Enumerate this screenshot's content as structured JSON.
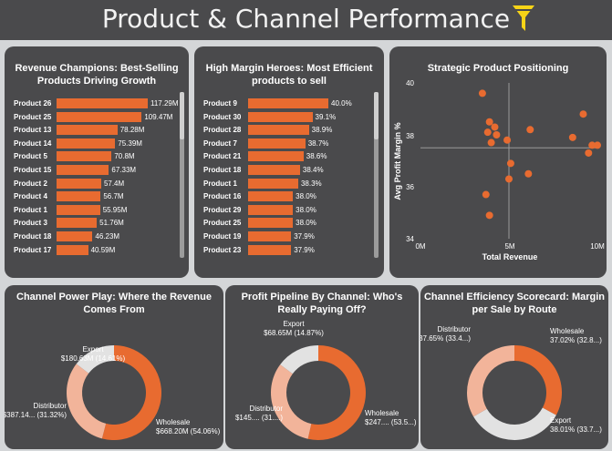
{
  "header": {
    "title": "Product & Channel Performance",
    "filter_icon": "filter-icon"
  },
  "colors": {
    "accent": "#e86b30",
    "panel": "#4a4a4c",
    "background": "#d4d6d8",
    "filter": "#f7d417"
  },
  "revenue_card": {
    "title_line1": "Revenue Champions: Best-Selling",
    "title_line2": "Products Driving Growth",
    "rows": [
      {
        "label": "Product 26",
        "value": "117.29M",
        "num": 117.29
      },
      {
        "label": "Product 25",
        "value": "109.47M",
        "num": 109.47
      },
      {
        "label": "Product 13",
        "value": "78.28M",
        "num": 78.28
      },
      {
        "label": "Product 14",
        "value": "75.39M",
        "num": 75.39
      },
      {
        "label": "Product 5",
        "value": "70.8M",
        "num": 70.8
      },
      {
        "label": "Product 15",
        "value": "67.33M",
        "num": 67.33
      },
      {
        "label": "Product 2",
        "value": "57.4M",
        "num": 57.4
      },
      {
        "label": "Product 4",
        "value": "56.7M",
        "num": 56.7
      },
      {
        "label": "Product 1",
        "value": "55.95M",
        "num": 55.95
      },
      {
        "label": "Product 3",
        "value": "51.76M",
        "num": 51.76
      },
      {
        "label": "Product 18",
        "value": "46.23M",
        "num": 46.23
      },
      {
        "label": "Product 17",
        "value": "40.59M",
        "num": 40.59
      }
    ]
  },
  "margin_card": {
    "title_line1": "High Margin Heroes: Most Efficient",
    "title_line2": "products to sell",
    "rows": [
      {
        "label": "Product 9",
        "value": "40.0%",
        "num": 40.0
      },
      {
        "label": "Product 30",
        "value": "39.1%",
        "num": 39.1
      },
      {
        "label": "Product 28",
        "value": "38.9%",
        "num": 38.9
      },
      {
        "label": "Product 7",
        "value": "38.7%",
        "num": 38.7
      },
      {
        "label": "Product 21",
        "value": "38.6%",
        "num": 38.6
      },
      {
        "label": "Product 18",
        "value": "38.4%",
        "num": 38.4
      },
      {
        "label": "Product 1",
        "value": "38.3%",
        "num": 38.3
      },
      {
        "label": "Product 16",
        "value": "38.0%",
        "num": 38.0
      },
      {
        "label": "Product 29",
        "value": "38.0%",
        "num": 38.0
      },
      {
        "label": "Product 25",
        "value": "38.0%",
        "num": 38.0
      },
      {
        "label": "Product 19",
        "value": "37.9%",
        "num": 37.9
      },
      {
        "label": "Product 23",
        "value": "37.9%",
        "num": 37.9
      }
    ]
  },
  "scatter_card": {
    "title": "Strategic Product Positioning",
    "xlabel": "Total Revenue",
    "ylabel": "Avg Profit Margin %",
    "x_ticks": [
      "0M",
      "5M",
      "10M"
    ],
    "y_ticks": [
      "40",
      "38",
      "36",
      "34"
    ],
    "mean_x": 5.0,
    "mean_y": 37.5
  },
  "chart_data": [
    {
      "type": "scatter",
      "title": "Strategic Product Positioning",
      "xlabel": "Total Revenue",
      "ylabel": "Avg Profit Margin %",
      "xlim": [
        0,
        10
      ],
      "ylim": [
        34,
        40
      ],
      "points": [
        {
          "x": 3.5,
          "y": 39.6
        },
        {
          "x": 3.9,
          "y": 38.5
        },
        {
          "x": 4.2,
          "y": 38.3
        },
        {
          "x": 3.8,
          "y": 38.1
        },
        {
          "x": 4.3,
          "y": 38.0
        },
        {
          "x": 4.0,
          "y": 37.7
        },
        {
          "x": 4.9,
          "y": 37.8
        },
        {
          "x": 6.2,
          "y": 38.2
        },
        {
          "x": 8.6,
          "y": 37.9
        },
        {
          "x": 9.2,
          "y": 38.8
        },
        {
          "x": 9.7,
          "y": 37.6
        },
        {
          "x": 10.0,
          "y": 37.6
        },
        {
          "x": 9.5,
          "y": 37.3
        },
        {
          "x": 5.1,
          "y": 36.9
        },
        {
          "x": 6.1,
          "y": 36.5
        },
        {
          "x": 5.0,
          "y": 36.3
        },
        {
          "x": 3.7,
          "y": 35.7
        },
        {
          "x": 3.9,
          "y": 34.9
        }
      ]
    },
    {
      "type": "pie",
      "title": "Channel Power Play: Where the Revenue Comes From",
      "slices": [
        {
          "name": "Wholesale",
          "label": "$668.20M (54.06%)",
          "value": 54.06,
          "color": "#e86b30"
        },
        {
          "name": "Distributor",
          "label": "$387.14... (31.32%)",
          "value": 31.32,
          "color": "#f2b49a"
        },
        {
          "name": "Export",
          "label": "$180.63M (14.61%)",
          "value": 14.61,
          "color": "#e2e2e2"
        }
      ]
    },
    {
      "type": "pie",
      "title": "Profit Pipeline By Channel: Who's Really Paying Off?",
      "slices": [
        {
          "name": "Wholesale",
          "label": "$247.... (53.5...)",
          "value": 53.5,
          "color": "#e86b30"
        },
        {
          "name": "Distributor",
          "label": "$145.... (31....)",
          "value": 31.6,
          "color": "#f2b49a"
        },
        {
          "name": "Export",
          "label": "$68.65M (14.87%)",
          "value": 14.87,
          "color": "#e2e2e2"
        }
      ]
    },
    {
      "type": "pie",
      "title": "Channel Efficiency Scorecard: Margin per Sale by Route",
      "slices": [
        {
          "name": "Wholesale",
          "label": "37.02% (32.8...)",
          "value": 32.8,
          "color": "#e86b30"
        },
        {
          "name": "Export",
          "label": "38.01% (33.7...)",
          "value": 33.7,
          "color": "#e2e2e2"
        },
        {
          "name": "Distributor",
          "label": "37.65% (33.4...)",
          "value": 33.4,
          "color": "#f2b49a"
        }
      ]
    }
  ],
  "donut1": {
    "title_line1": "Channel Power Play: Where the Revenue",
    "title_line2": "Comes From"
  },
  "donut2": {
    "title_line1": "Profit Pipeline By Channel: Who's",
    "title_line2": "Really Paying Off?"
  },
  "donut3": {
    "title_line1": "Channel Efficiency Scorecard: Margin",
    "title_line2": "per Sale by Route"
  }
}
